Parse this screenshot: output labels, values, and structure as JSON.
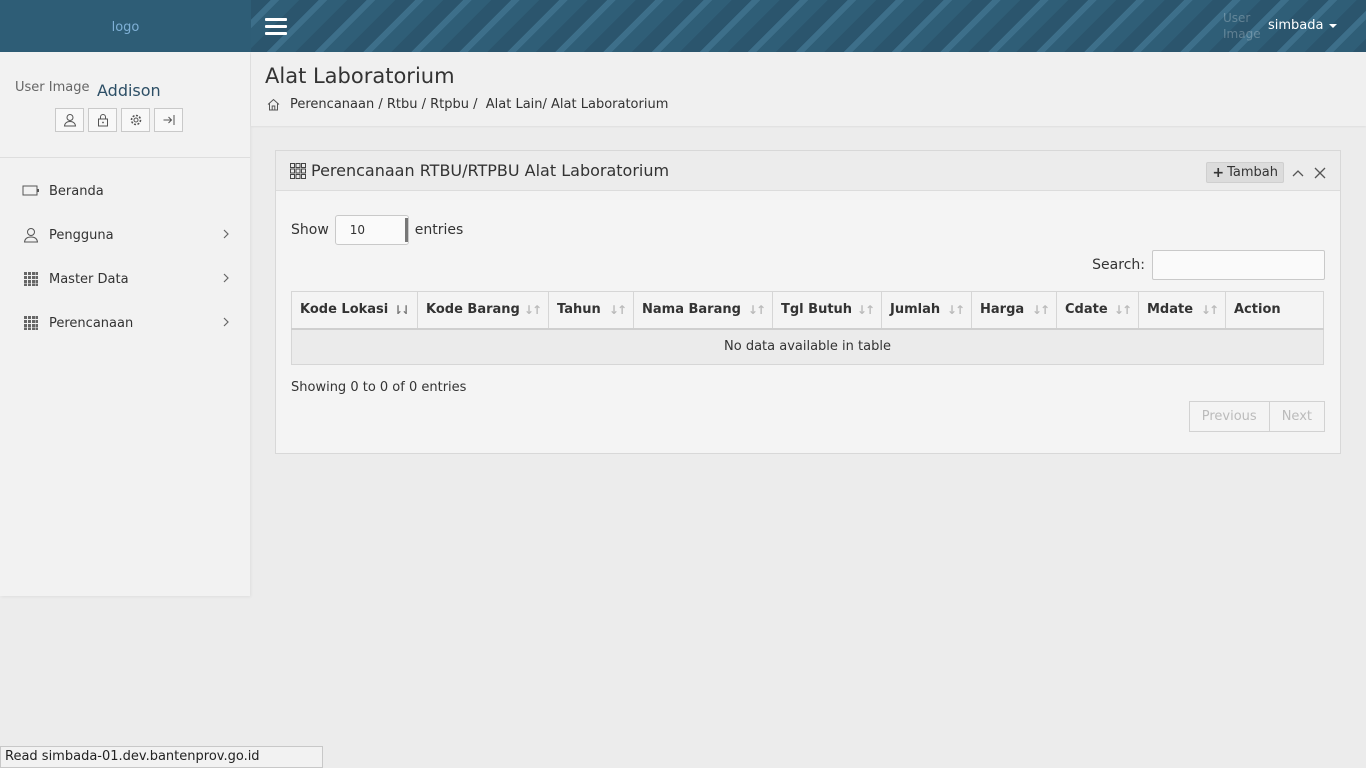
{
  "header": {
    "logo_text": "logo",
    "user_image_alt": "User Image",
    "user_menu_label": "simbada"
  },
  "sidebar": {
    "profile": {
      "user_image_alt": "User Image",
      "name": "Addison",
      "buttons": [
        "user-icon",
        "lock-icon",
        "gear-icon",
        "logout-icon"
      ]
    },
    "items": [
      {
        "label": "Beranda",
        "icon": "dashboard-icon",
        "has_children": false
      },
      {
        "label": "Pengguna",
        "icon": "user-icon",
        "has_children": true
      },
      {
        "label": "Master Data",
        "icon": "grid-icon",
        "has_children": true
      },
      {
        "label": "Perencanaan",
        "icon": "grid-icon",
        "has_children": true
      }
    ]
  },
  "page": {
    "title": "Alat Laboratorium",
    "breadcrumb": "Perencanaan / Rtbu / Rtpbu /  Alat Lain/ Alat Laboratorium"
  },
  "box": {
    "title": "Perencanaan RTBU/RTPBU Alat Laboratorium",
    "add_label": "Tambah"
  },
  "table": {
    "show_label": "Show",
    "entries_label": "entries",
    "page_length": "10",
    "search_label": "Search:",
    "search_value": "",
    "columns": [
      "Kode Lokasi",
      "Kode Barang",
      "Tahun",
      "Nama Barang",
      "Tgl Butuh",
      "Jumlah",
      "Harga",
      "Cdate",
      "Mdate",
      "Action"
    ],
    "empty_text": "No data available in table",
    "info": "Showing 0 to 0 of 0 entries",
    "prev_label": "Previous",
    "next_label": "Next"
  },
  "statusbar": {
    "text": "Read simbada-01.dev.bantenprov.go.id"
  },
  "colors": {
    "header": "#2d5b74",
    "sidebar": "#f2f2f2",
    "background": "#ececec"
  }
}
